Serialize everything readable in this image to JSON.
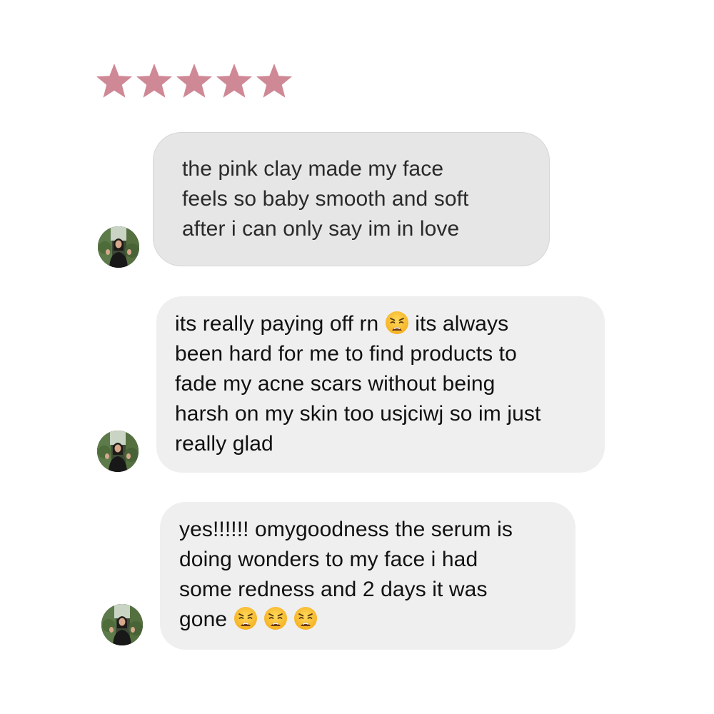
{
  "rating": {
    "stars": 5,
    "max": 5,
    "color": "#cf8895"
  },
  "messages": [
    {
      "text": "the pink clay made my face feels so baby smooth and soft after i can only say im in love",
      "lines": [
        "the pink clay made my face",
        "feels so baby smooth and soft",
        "after i can only say im in love"
      ],
      "bubble_color": "#e6e6e6"
    },
    {
      "text": "its really paying off rn 😩 its always been hard for me to find products to fade my acne scars without being harsh on my skin too usjciwj so im just really glad",
      "lines": [
        "its really paying off rn ",
        " its always",
        "been hard for me to find products to",
        "fade my acne scars without being",
        "harsh on my skin too usjciwj so im just",
        "really glad"
      ],
      "bubble_color": "#efefef"
    },
    {
      "text": "yes!!!!!! omygoodness the serum is doing wonders to my face i had some redness and 2 days it was gone 😩 😩 😩",
      "lines": [
        "yes!!!!!! omygoodness the serum is",
        "doing wonders to my face i had",
        "some redness and 2 days it was",
        "gone "
      ],
      "bubble_color": "#efefef"
    }
  ],
  "icons": {
    "star": "star-icon",
    "avatar": "user-avatar",
    "emoji": "weary-face-emoji"
  }
}
